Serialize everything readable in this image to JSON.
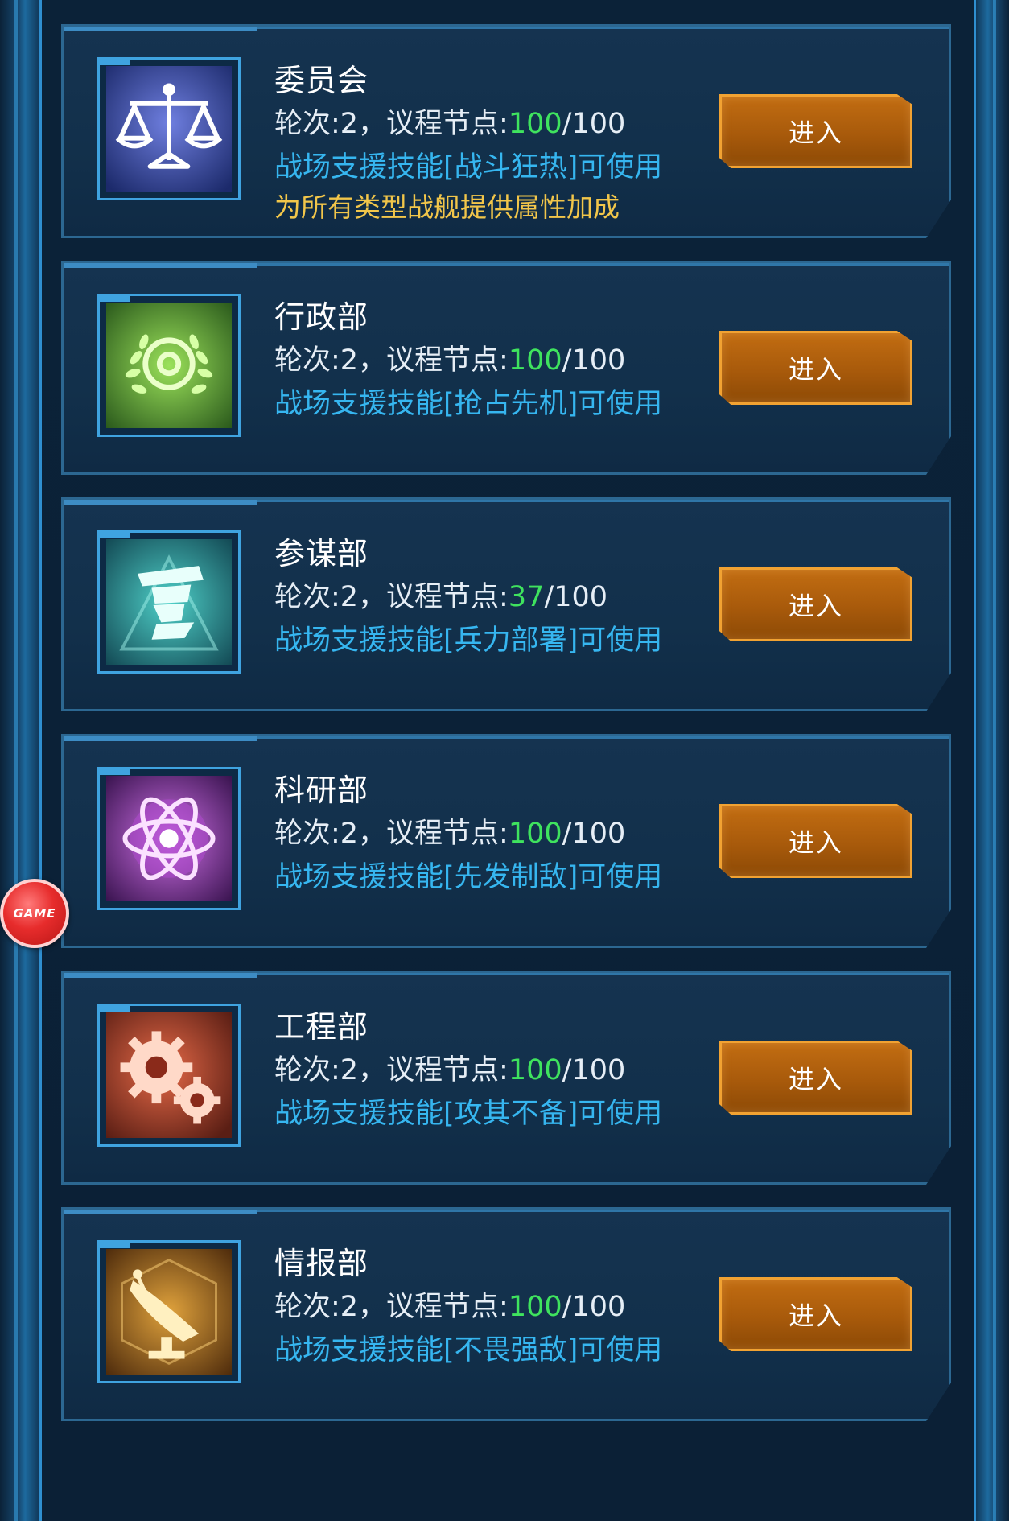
{
  "departments": [
    {
      "name": "委员会",
      "stats_prefix": "轮次:2，议程节点:",
      "current": "100",
      "total_suffix": "/100",
      "skill": "战场支援技能[战斗狂热]可使用",
      "description": "为所有类型战舰提供属性加成",
      "icon": "scales-icon",
      "button_label": "进入"
    },
    {
      "name": "行政部",
      "stats_prefix": "轮次:2，议程节点:",
      "current": "100",
      "total_suffix": "/100",
      "skill": "战场支援技能[抢占先机]可使用",
      "icon": "laurel-emblem-icon",
      "button_label": "进入"
    },
    {
      "name": "参谋部",
      "stats_prefix": "轮次:2，议程节点:",
      "current": "37",
      "total_suffix": "/100",
      "skill": "战场支援技能[兵力部署]可使用",
      "icon": "officer-cap-icon",
      "button_label": "进入"
    },
    {
      "name": "科研部",
      "stats_prefix": "轮次:2，议程节点:",
      "current": "100",
      "total_suffix": "/100",
      "skill": "战场支援技能[先发制敌]可使用",
      "icon": "atom-icon",
      "button_label": "进入"
    },
    {
      "name": "工程部",
      "stats_prefix": "轮次:2，议程节点:",
      "current": "100",
      "total_suffix": "/100",
      "skill": "战场支援技能[攻其不备]可使用",
      "icon": "gears-icon",
      "button_label": "进入"
    },
    {
      "name": "情报部",
      "stats_prefix": "轮次:2，议程节点:",
      "current": "100",
      "total_suffix": "/100",
      "skill": "战场支援技能[不畏强敌]可使用",
      "icon": "radar-dish-icon",
      "button_label": "进入"
    }
  ],
  "floating_button": {
    "label": "GAME"
  },
  "colors": {
    "progress_value": "#3fe35e",
    "skill_text": "#36b6f0",
    "description_text": "#f2c64a",
    "button_fill": "#b8640e",
    "button_border": "#f1a232"
  }
}
